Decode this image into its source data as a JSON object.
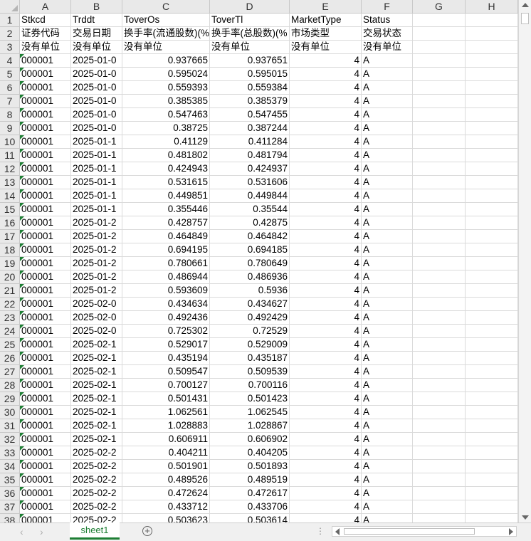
{
  "columns": [
    "A",
    "B",
    "C",
    "D",
    "E",
    "F",
    "G",
    "H"
  ],
  "header_rows": [
    [
      "Stkcd",
      "Trddt",
      "ToverOs",
      "ToverTl",
      "MarketType",
      "Status"
    ],
    [
      "证券代码",
      "交易日期",
      "换手率(流通股数)(%",
      "换手率(总股数)(%",
      "市场类型",
      "交易状态"
    ],
    [
      "没有单位",
      "没有单位",
      "没有单位",
      "没有单位",
      "没有单位",
      "没有单位"
    ]
  ],
  "data_rows": [
    [
      "000001",
      "2025-01-0",
      "0.937665",
      "0.937651",
      "4",
      "A"
    ],
    [
      "000001",
      "2025-01-0",
      "0.595024",
      "0.595015",
      "4",
      "A"
    ],
    [
      "000001",
      "2025-01-0",
      "0.559393",
      "0.559384",
      "4",
      "A"
    ],
    [
      "000001",
      "2025-01-0",
      "0.385385",
      "0.385379",
      "4",
      "A"
    ],
    [
      "000001",
      "2025-01-0",
      "0.547463",
      "0.547455",
      "4",
      "A"
    ],
    [
      "000001",
      "2025-01-0",
      "0.38725",
      "0.387244",
      "4",
      "A"
    ],
    [
      "000001",
      "2025-01-1",
      "0.41129",
      "0.411284",
      "4",
      "A"
    ],
    [
      "000001",
      "2025-01-1",
      "0.481802",
      "0.481794",
      "4",
      "A"
    ],
    [
      "000001",
      "2025-01-1",
      "0.424943",
      "0.424937",
      "4",
      "A"
    ],
    [
      "000001",
      "2025-01-1",
      "0.531615",
      "0.531606",
      "4",
      "A"
    ],
    [
      "000001",
      "2025-01-1",
      "0.449851",
      "0.449844",
      "4",
      "A"
    ],
    [
      "000001",
      "2025-01-1",
      "0.355446",
      "0.35544",
      "4",
      "A"
    ],
    [
      "000001",
      "2025-01-2",
      "0.428757",
      "0.42875",
      "4",
      "A"
    ],
    [
      "000001",
      "2025-01-2",
      "0.464849",
      "0.464842",
      "4",
      "A"
    ],
    [
      "000001",
      "2025-01-2",
      "0.694195",
      "0.694185",
      "4",
      "A"
    ],
    [
      "000001",
      "2025-01-2",
      "0.780661",
      "0.780649",
      "4",
      "A"
    ],
    [
      "000001",
      "2025-01-2",
      "0.486944",
      "0.486936",
      "4",
      "A"
    ],
    [
      "000001",
      "2025-01-2",
      "0.593609",
      "0.5936",
      "4",
      "A"
    ],
    [
      "000001",
      "2025-02-0",
      "0.434634",
      "0.434627",
      "4",
      "A"
    ],
    [
      "000001",
      "2025-02-0",
      "0.492436",
      "0.492429",
      "4",
      "A"
    ],
    [
      "000001",
      "2025-02-0",
      "0.725302",
      "0.72529",
      "4",
      "A"
    ],
    [
      "000001",
      "2025-02-1",
      "0.529017",
      "0.529009",
      "4",
      "A"
    ],
    [
      "000001",
      "2025-02-1",
      "0.435194",
      "0.435187",
      "4",
      "A"
    ],
    [
      "000001",
      "2025-02-1",
      "0.509547",
      "0.509539",
      "4",
      "A"
    ],
    [
      "000001",
      "2025-02-1",
      "0.700127",
      "0.700116",
      "4",
      "A"
    ],
    [
      "000001",
      "2025-02-1",
      "0.501431",
      "0.501423",
      "4",
      "A"
    ],
    [
      "000001",
      "2025-02-1",
      "1.062561",
      "1.062545",
      "4",
      "A"
    ],
    [
      "000001",
      "2025-02-1",
      "1.028883",
      "1.028867",
      "4",
      "A"
    ],
    [
      "000001",
      "2025-02-1",
      "0.606911",
      "0.606902",
      "4",
      "A"
    ],
    [
      "000001",
      "2025-02-2",
      "0.404211",
      "0.404205",
      "4",
      "A"
    ],
    [
      "000001",
      "2025-02-2",
      "0.501901",
      "0.501893",
      "4",
      "A"
    ],
    [
      "000001",
      "2025-02-2",
      "0.489526",
      "0.489519",
      "4",
      "A"
    ],
    [
      "000001",
      "2025-02-2",
      "0.472624",
      "0.472617",
      "4",
      "A"
    ],
    [
      "000001",
      "2025-02-2",
      "0.433712",
      "0.433706",
      "4",
      "A"
    ],
    [
      "000001",
      "2025-02-2",
      "0.503623",
      "0.503614",
      "4",
      "A"
    ]
  ],
  "column_alignment": [
    "txt",
    "txt",
    "num",
    "num",
    "num",
    "txt",
    "txt",
    "txt"
  ],
  "green_flag_column": "A",
  "sheet_tab": "sheet1",
  "add_sheet_symbol": "+",
  "colors": {
    "accent": "#1e7e34",
    "header_bg": "#e9e9e9",
    "gridline": "#dadada"
  },
  "icons": {
    "select_all": "select-all-triangle-icon",
    "sheet_prev": "chevron-left-icon",
    "sheet_next": "chevron-right-icon",
    "add_sheet": "plus-circle-icon",
    "more": "vertical-dots-icon"
  }
}
